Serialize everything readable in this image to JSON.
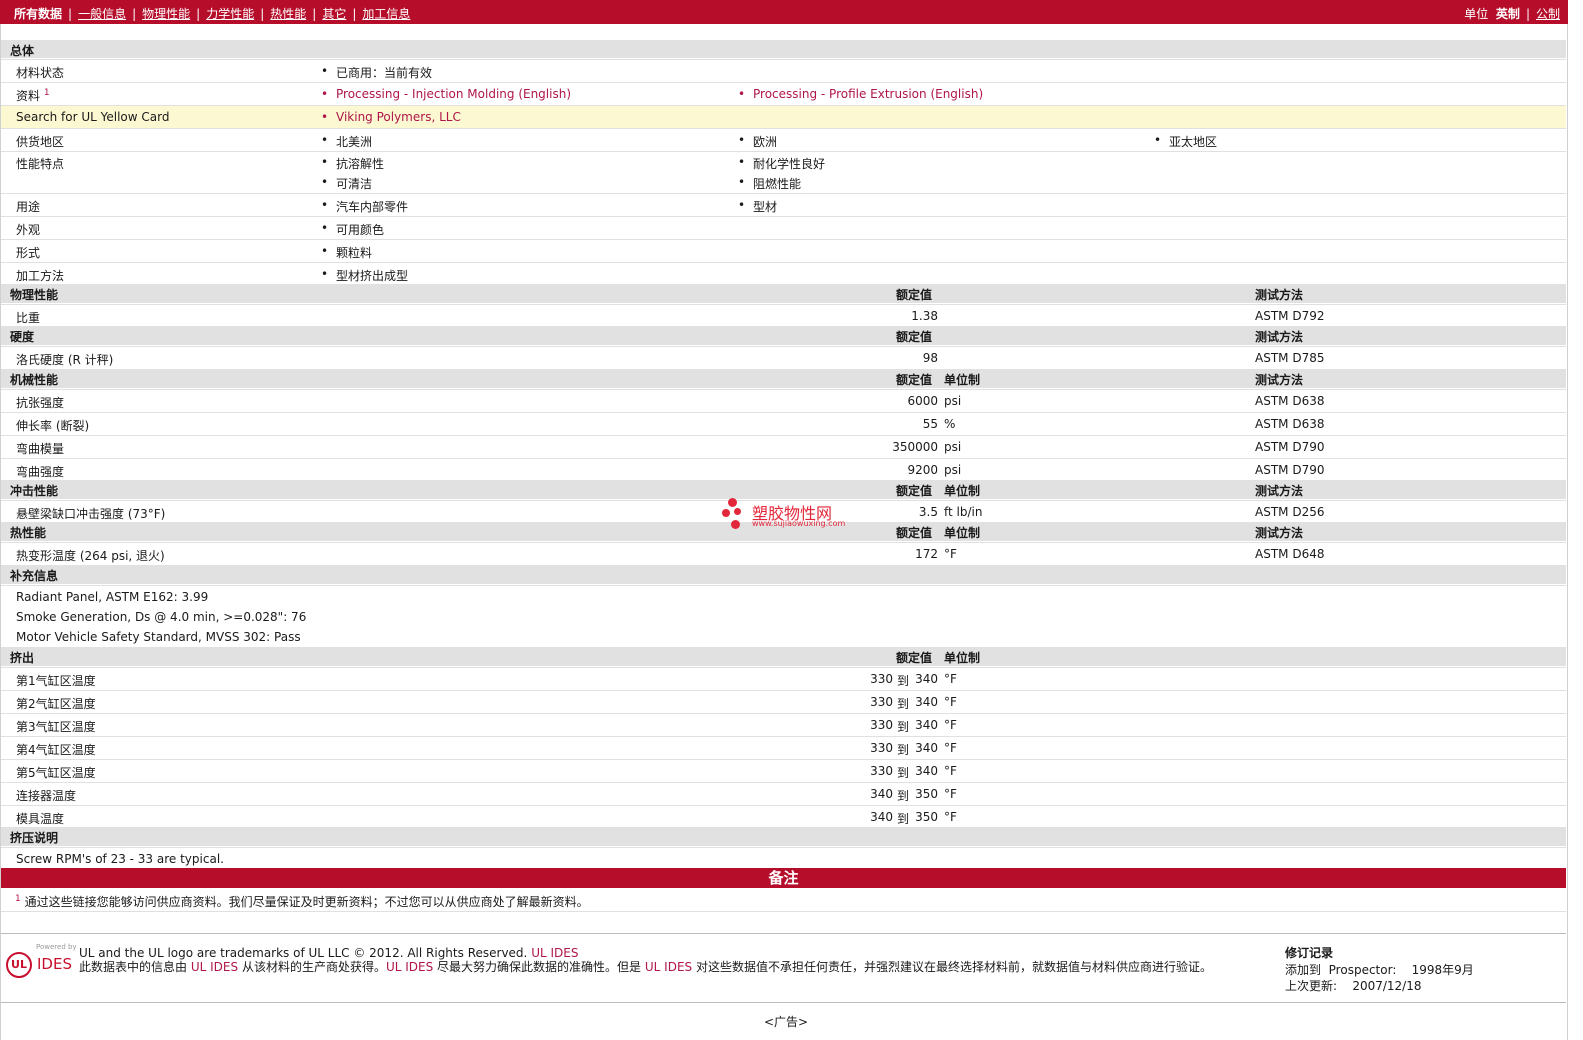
{
  "nav": {
    "all_data": "所有数据",
    "tabs": [
      "一般信息",
      "物理性能",
      "力学性能",
      "热性能",
      "其它",
      "加工信息"
    ],
    "units_label": "单位",
    "units_imperial": "英制",
    "units_metric": "公制"
  },
  "general": {
    "title": "总体",
    "rows": [
      {
        "label": "材料状态",
        "values": [
          "已商用：当前有效"
        ]
      },
      {
        "label": "资料",
        "sup": "1",
        "links": [
          "Processing - Injection Molding (English)",
          "Processing - Profile Extrusion (English)"
        ]
      },
      {
        "label": "Search for UL Yellow Card",
        "links": [
          "Viking Polymers, LLC"
        ]
      },
      {
        "label": "供货地区",
        "values": [
          "北美洲",
          "欧洲",
          "亚太地区"
        ]
      },
      {
        "label": "性能特点",
        "values": [
          "抗溶解性",
          "耐化学性良好",
          "可清洁",
          "阻燃性能"
        ]
      },
      {
        "label": "用途",
        "values": [
          "汽车内部零件",
          "型材"
        ]
      },
      {
        "label": "外观",
        "values": [
          "可用颜色"
        ]
      },
      {
        "label": "形式",
        "values": [
          "颗粒料"
        ]
      },
      {
        "label": "加工方法",
        "values": [
          "型材挤出成型"
        ]
      }
    ]
  },
  "col": {
    "nominal": "额定值",
    "unit": "单位制",
    "method": "测试方法",
    "to": "到"
  },
  "physical": {
    "title": "物理性能",
    "rows": [
      {
        "label": "比重",
        "value": "1.38",
        "unit": "",
        "method": "ASTM D792"
      }
    ]
  },
  "hardness": {
    "title": "硬度",
    "rows": [
      {
        "label": "洛氏硬度 (R 计秤)",
        "value": "98",
        "unit": "",
        "method": "ASTM D785"
      }
    ]
  },
  "mechanical": {
    "title": "机械性能",
    "rows": [
      {
        "label": "抗张强度",
        "value": "6000",
        "unit": "psi",
        "method": "ASTM D638"
      },
      {
        "label": "伸长率 (断裂)",
        "value": "55",
        "unit": "%",
        "method": "ASTM D638"
      },
      {
        "label": "弯曲模量",
        "value": "350000",
        "unit": "psi",
        "method": "ASTM D790"
      },
      {
        "label": "弯曲强度",
        "value": "9200",
        "unit": "psi",
        "method": "ASTM D790"
      }
    ]
  },
  "impact": {
    "title": "冲击性能",
    "rows": [
      {
        "label": "悬壁梁缺口冲击强度 (73°F)",
        "value": "3.5",
        "unit": "ft lb/in",
        "method": "ASTM D256"
      }
    ]
  },
  "thermal": {
    "title": "热性能",
    "rows": [
      {
        "label": "热变形温度 (264 psi, 退火)",
        "value": "172",
        "unit": "°F",
        "method": "ASTM D648"
      }
    ]
  },
  "supplement": {
    "title": "补充信息",
    "lines": [
      "Radiant Panel, ASTM E162: 3.99",
      "Smoke Generation, Ds @ 4.0 min, >=0.028\": 76",
      "Motor Vehicle Safety Standard, MVSS 302: Pass"
    ]
  },
  "extrusion": {
    "title": "挤出",
    "rows": [
      {
        "label": "第1气缸区温度",
        "from": "330",
        "to": "340",
        "unit": "°F"
      },
      {
        "label": "第2气缸区温度",
        "from": "330",
        "to": "340",
        "unit": "°F"
      },
      {
        "label": "第3气缸区温度",
        "from": "330",
        "to": "340",
        "unit": "°F"
      },
      {
        "label": "第4气缸区温度",
        "from": "330",
        "to": "340",
        "unit": "°F"
      },
      {
        "label": "第5气缸区温度",
        "from": "330",
        "to": "340",
        "unit": "°F"
      },
      {
        "label": "连接器温度",
        "from": "340",
        "to": "350",
        "unit": "°F"
      },
      {
        "label": "模具温度",
        "from": "340",
        "to": "350",
        "unit": "°F"
      }
    ]
  },
  "extrusion_notes": {
    "title": "挤压说明",
    "text": "Screw RPM's of 23 - 33 are typical."
  },
  "notes": {
    "title": "备注",
    "sup": "1",
    "text": "通过这些链接您能够访问供应商资料。我们尽量保证及时更新资料；不过您可以从供应商处了解最新资料。"
  },
  "watermark": {
    "text": "塑胶物性网",
    "url": "www.sujiaowuxing.com"
  },
  "footer": {
    "logo_powered": "Powered by",
    "logo_ul": "UL",
    "logo_ides": "IDES",
    "line1_prefix": "UL and the UL logo are trademarks of UL LLC © 2012. All Rights Reserved.",
    "line1_link": "UL IDES",
    "line2_a": "此数据表中的信息由",
    "line2_link1": "UL IDES",
    "line2_b": "从该材料的生产商处获得。",
    "line2_link2": "UL IDES",
    "line2_c": "尽最大努力确保此数据的准确性。但是",
    "line2_link3": "UL IDES",
    "line2_d": "对这些数据值不承担任何责任，并强烈建议在最终选择材料前，就数据值与材料供应商进行验证。",
    "rev_title": "修订记录",
    "added_label": "添加到",
    "added_where": "Prospector:",
    "added_date": "1998年9月",
    "updated_label": "上次更新:",
    "updated_date": "2007/12/18"
  },
  "ad": "<广告>"
}
